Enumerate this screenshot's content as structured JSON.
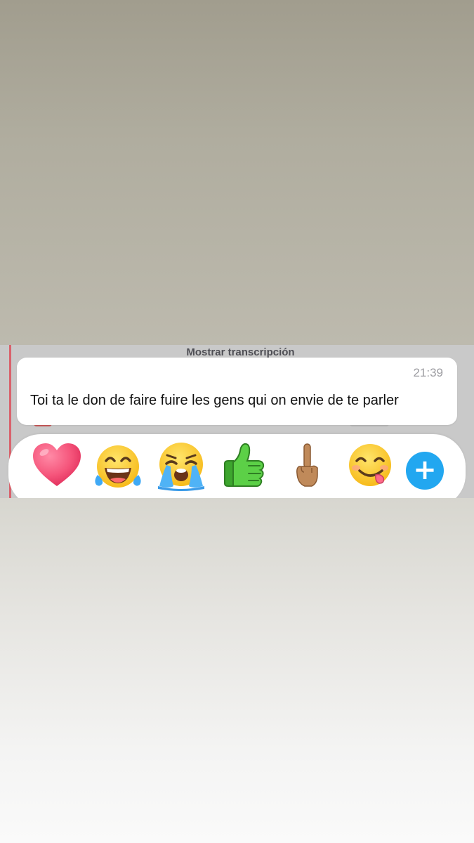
{
  "chat": {
    "transcription_link": "Mostrar transcripción",
    "message": {
      "time": "21:39",
      "text": "Toi ta le don de faire fuire les gens qui on envie de te parler"
    }
  },
  "reaction_bar": {
    "reactions": [
      {
        "icon": "red-heart-icon"
      },
      {
        "icon": "tears-of-joy-icon"
      },
      {
        "icon": "loudly-crying-face-icon"
      },
      {
        "icon": "thumbs-up-icon"
      },
      {
        "icon": "middle-finger-icon"
      },
      {
        "icon": "face-savoring-food-icon"
      }
    ],
    "add_icon": "plus-icon",
    "add_label": "+"
  },
  "colors": {
    "accent": "#22a7f0",
    "bubble": "#ffffff",
    "heart": "#f5557b",
    "thumbs": "#4cc43c"
  }
}
